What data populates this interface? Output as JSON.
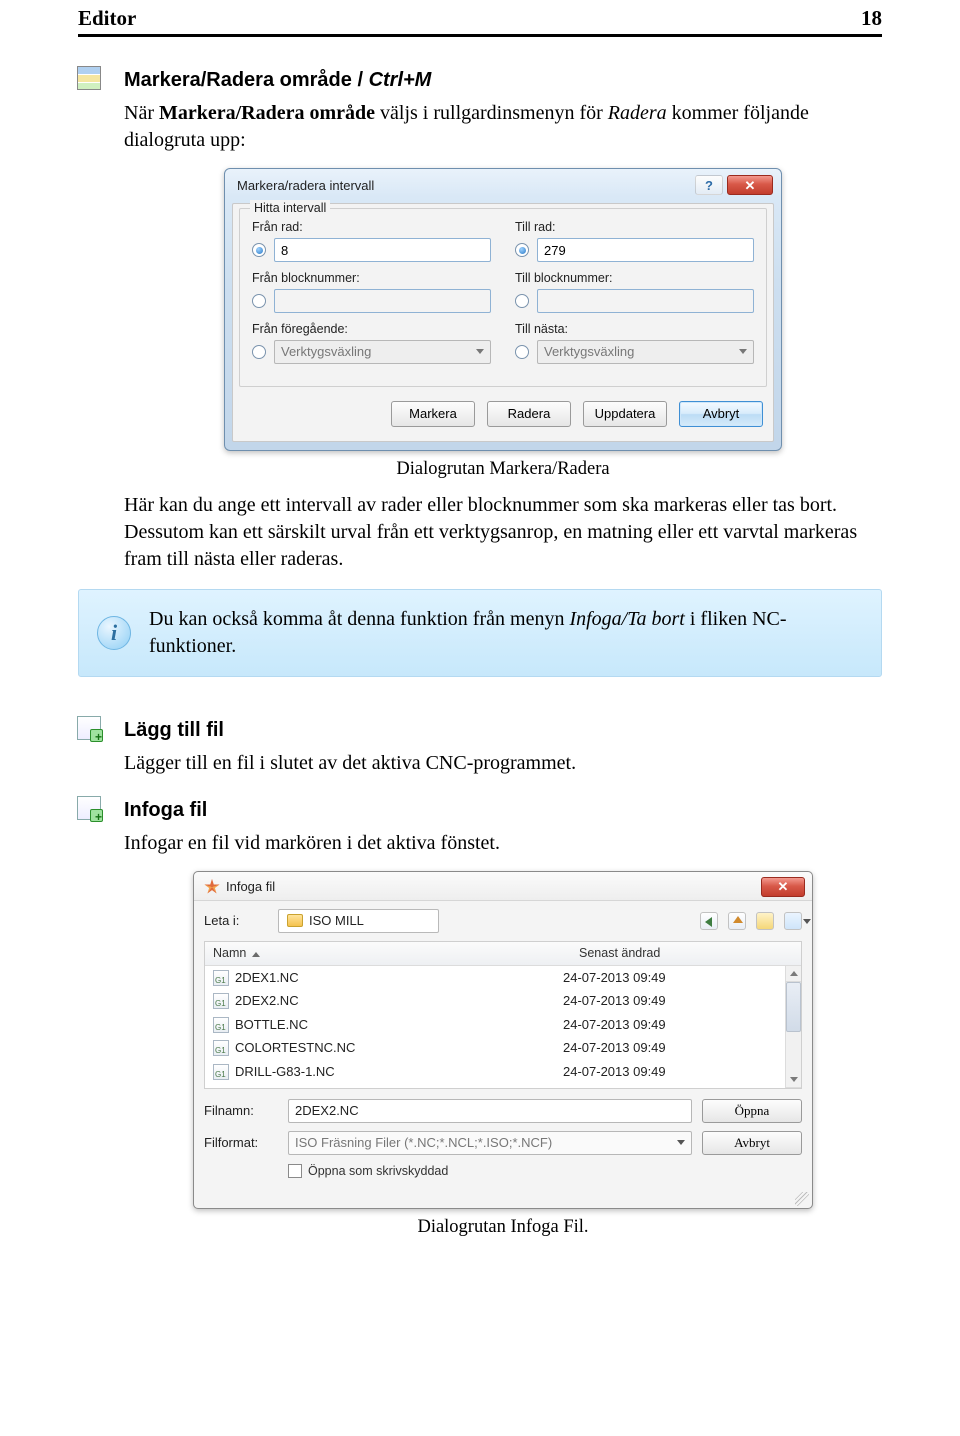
{
  "header": {
    "title": "Editor",
    "page": "18"
  },
  "sec1": {
    "heading_prefix": "Markera/Radera område / ",
    "heading_shortcut": "Ctrl+M",
    "intro_a": "När ",
    "intro_b": "Markera/Radera område",
    "intro_c": " väljs i rullgardinsmenyn för ",
    "intro_d": "Radera",
    "intro_e": " kommer följande dialogruta upp:",
    "caption": "Dialogrutan Markera/Radera",
    "after1": "Här kan du ange ett intervall av rader eller blocknummer som ska markeras eller tas bort. Dessutom kan ett särskilt urval från ett verktygsanrop, en matning eller ett varvtal markeras fram till nästa eller raderas.",
    "callout_a": "Du kan också komma åt denna funktion från menyn ",
    "callout_b": "Infoga/Ta bort",
    "callout_c": " i fliken NC-funktioner."
  },
  "dlg1": {
    "title": "Markera/radera intervall",
    "legend": "Hitta intervall",
    "from_row_label": "Från rad:",
    "to_row_label": "Till rad:",
    "from_row_value": "8",
    "to_row_value": "279",
    "from_block_label": "Från blocknummer:",
    "to_block_label": "Till blocknummer:",
    "from_prev_label": "Från föregående:",
    "to_next_label": "Till nästa:",
    "tool_change": "Verktygsväxling",
    "btn_mark": "Markera",
    "btn_delete": "Radera",
    "btn_update": "Uppdatera",
    "btn_cancel": "Avbryt"
  },
  "sec2": {
    "heading": "Lägg till fil",
    "body": "Lägger till en fil i slutet av det aktiva CNC-programmet."
  },
  "sec3": {
    "heading": "Infoga fil",
    "body": "Infogar en fil vid markören i det aktiva fönstet.",
    "caption": "Dialogrutan Infoga Fil."
  },
  "ofd": {
    "title": "Infoga fil",
    "lookin_label": "Leta i:",
    "folder": "ISO MILL",
    "col_name": "Namn",
    "col_date": "Senast ändrad",
    "files": [
      {
        "name": "2DEX1.NC",
        "date": "24-07-2013 09:49"
      },
      {
        "name": "2DEX2.NC",
        "date": "24-07-2013 09:49"
      },
      {
        "name": "BOTTLE.NC",
        "date": "24-07-2013 09:49"
      },
      {
        "name": "COLORTESTNC.NC",
        "date": "24-07-2013 09:49"
      },
      {
        "name": "DRILL-G83-1.NC",
        "date": "24-07-2013 09:49"
      }
    ],
    "fname_label": "Filnamn:",
    "fname_value": "2DEX2.NC",
    "ftype_label": "Filformat:",
    "ftype_value": "ISO Fräsning Filer (*.NC;*.NCL;*.ISO;*.NCF)",
    "btn_open": "Öppna",
    "btn_cancel": "Avbryt",
    "readonly_label": "Öppna som skrivskyddad"
  }
}
